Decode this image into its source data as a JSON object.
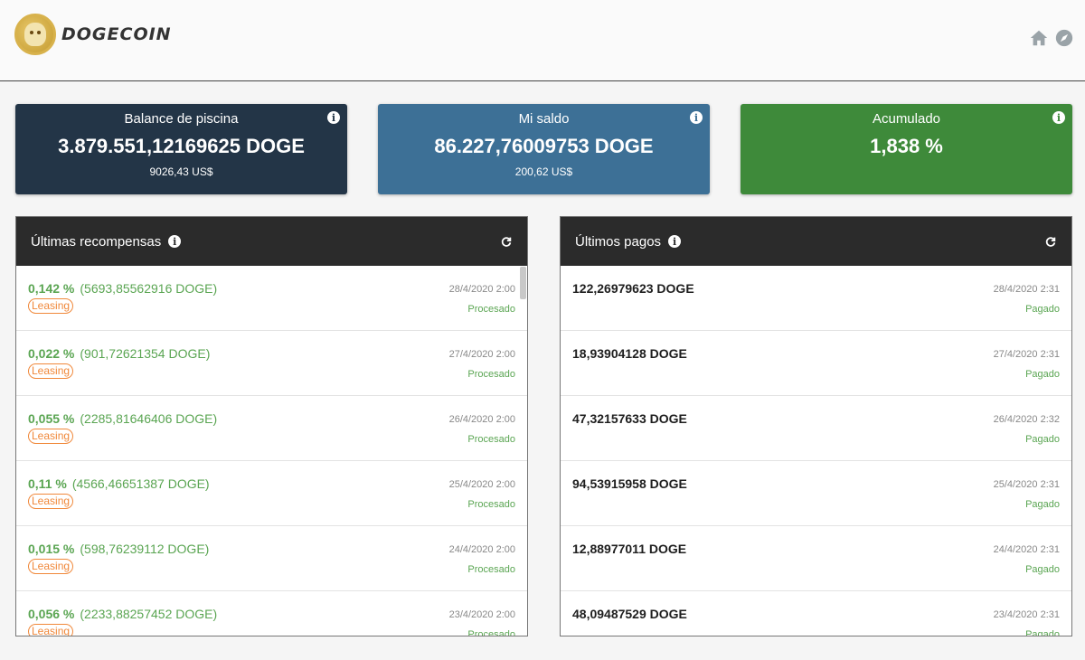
{
  "header": {
    "brand": "DOGECOIN",
    "icons": [
      "home-icon",
      "compass-icon"
    ]
  },
  "stats": {
    "pool": {
      "title": "Balance de piscina",
      "value": "3.879.551,12169625 DOGE",
      "sub": "9026,43 US$",
      "info_icon": "info-icon"
    },
    "mine": {
      "title": "Mi saldo",
      "value": "86.227,76009753 DOGE",
      "sub": "200,62 US$",
      "info_icon": "info-icon"
    },
    "accumulated": {
      "title": "Acumulado",
      "value": "1,838 %",
      "info_icon": "info-icon"
    }
  },
  "rewards": {
    "title": "Últimas recompensas",
    "rows": [
      {
        "pct": "0,142 %",
        "doge": "(5693,85562916 DOGE)",
        "tag": "Leasing",
        "date": "28/4/2020 2:00",
        "status": "Procesado"
      },
      {
        "pct": "0,022 %",
        "doge": "(901,72621354 DOGE)",
        "tag": "Leasing",
        "date": "27/4/2020 2:00",
        "status": "Procesado"
      },
      {
        "pct": "0,055 %",
        "doge": "(2285,81646406 DOGE)",
        "tag": "Leasing",
        "date": "26/4/2020 2:00",
        "status": "Procesado"
      },
      {
        "pct": "0,11 %",
        "doge": "(4566,46651387 DOGE)",
        "tag": "Leasing",
        "date": "25/4/2020 2:00",
        "status": "Procesado"
      },
      {
        "pct": "0,015 %",
        "doge": "(598,76239112 DOGE)",
        "tag": "Leasing",
        "date": "24/4/2020 2:00",
        "status": "Procesado"
      },
      {
        "pct": "0,056 %",
        "doge": "(2233,88257452 DOGE)",
        "tag": "Leasing",
        "date": "23/4/2020 2:00",
        "status": "Procesado"
      }
    ]
  },
  "payments": {
    "title": "Últimos pagos",
    "rows": [
      {
        "amount": "122,26979623 DOGE",
        "date": "28/4/2020 2:31",
        "status": "Pagado"
      },
      {
        "amount": "18,93904128 DOGE",
        "date": "27/4/2020 2:31",
        "status": "Pagado"
      },
      {
        "amount": "47,32157633 DOGE",
        "date": "26/4/2020 2:32",
        "status": "Pagado"
      },
      {
        "amount": "94,53915958 DOGE",
        "date": "25/4/2020 2:31",
        "status": "Pagado"
      },
      {
        "amount": "12,88977011 DOGE",
        "date": "24/4/2020 2:31",
        "status": "Pagado"
      },
      {
        "amount": "48,09487529 DOGE",
        "date": "23/4/2020 2:31",
        "status": "Pagado"
      }
    ]
  },
  "colors": {
    "pool_card": "#233547",
    "mine_card": "#3d7096",
    "accumulated_card": "#3e8a3a",
    "panel_header": "#2b2b2b",
    "positive_green": "#5aa552",
    "leasing_orange": "#f0883a"
  }
}
